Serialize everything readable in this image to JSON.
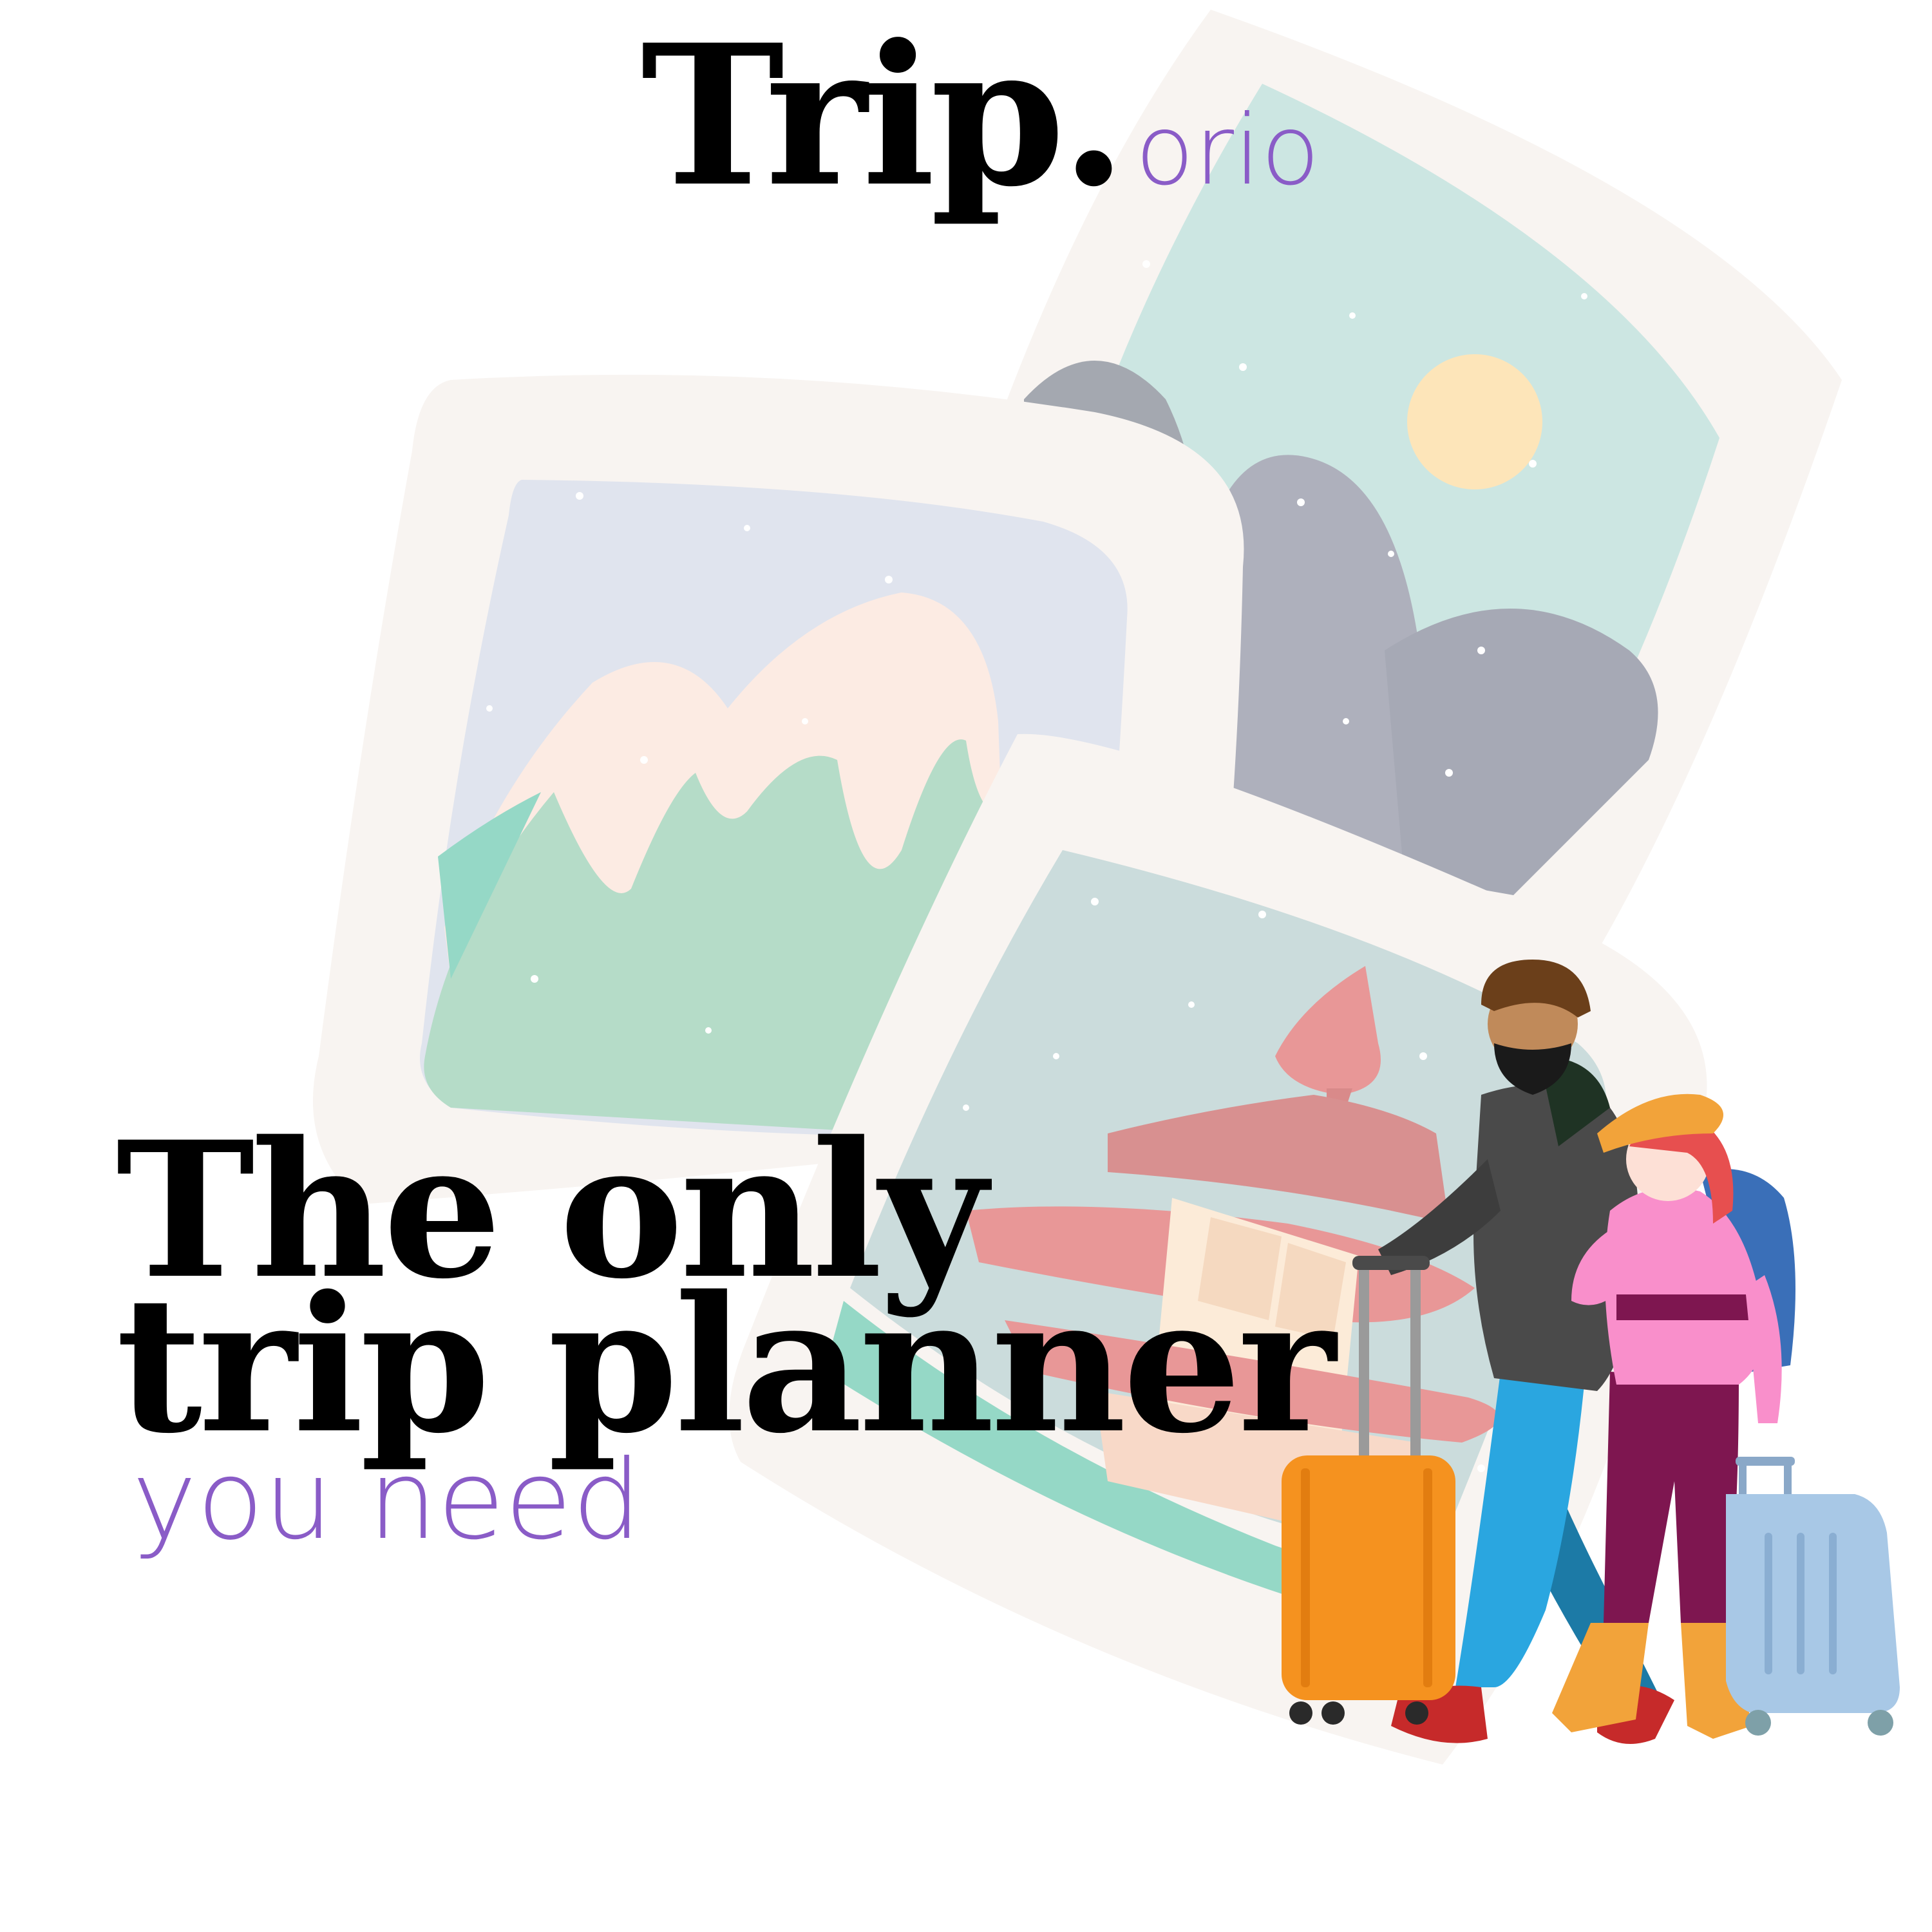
{
  "brand": {
    "name": "Trip.",
    "suffix": "orio"
  },
  "headline": {
    "line1": "The only",
    "line2": "trip planner"
  },
  "tagline": "you need",
  "colors": {
    "accent": "#8a5cc7",
    "text": "#000000",
    "frame": "#f8f4f1",
    "mint": "#cce6e2",
    "orange_suitcase": "#f5921f",
    "blue_suitcase": "#a8c8e6"
  },
  "illustration": {
    "photo_frames": 3,
    "travelers": 2
  }
}
